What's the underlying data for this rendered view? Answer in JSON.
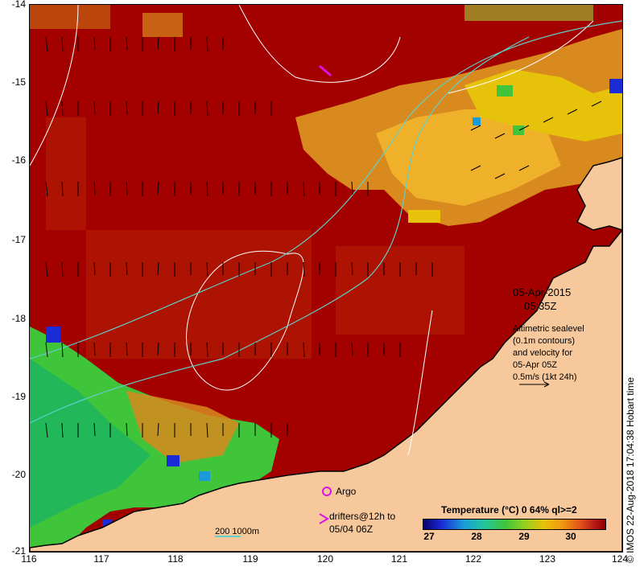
{
  "map": {
    "y_ticks": [
      "-14",
      "-15",
      "-16",
      "-17",
      "-18",
      "-19",
      "-20",
      "-21"
    ],
    "x_ticks": [
      "116",
      "117",
      "118",
      "119",
      "120",
      "121",
      "122",
      "123",
      "124"
    ],
    "date": "05-Apr-2015",
    "time": "05:35Z",
    "altimetry_note": [
      "Altimetric sealevel",
      "(0.1m contours)",
      "and velocity for",
      "05-Apr 05Z",
      "0.5m/s (1kt 24h)"
    ],
    "argo_label": "Argo",
    "drifters_label": [
      "drifters@12h to",
      "05/04 06Z"
    ],
    "bathy_label": "200  1000m",
    "colorbar_title": "Temperature (°C) 0 64% ql>=2",
    "colorbar_ticks": [
      "27",
      "28",
      "29",
      "30"
    ],
    "timestamp": "© IMOS 22-Aug-2018 17:04:38 Hobart time"
  },
  "colors": {
    "ocean_hot": "#a30000",
    "land": "#f7c89b",
    "argo": "#e010e0",
    "bathy": "#5fd0c8",
    "contour": "#ffffff"
  }
}
